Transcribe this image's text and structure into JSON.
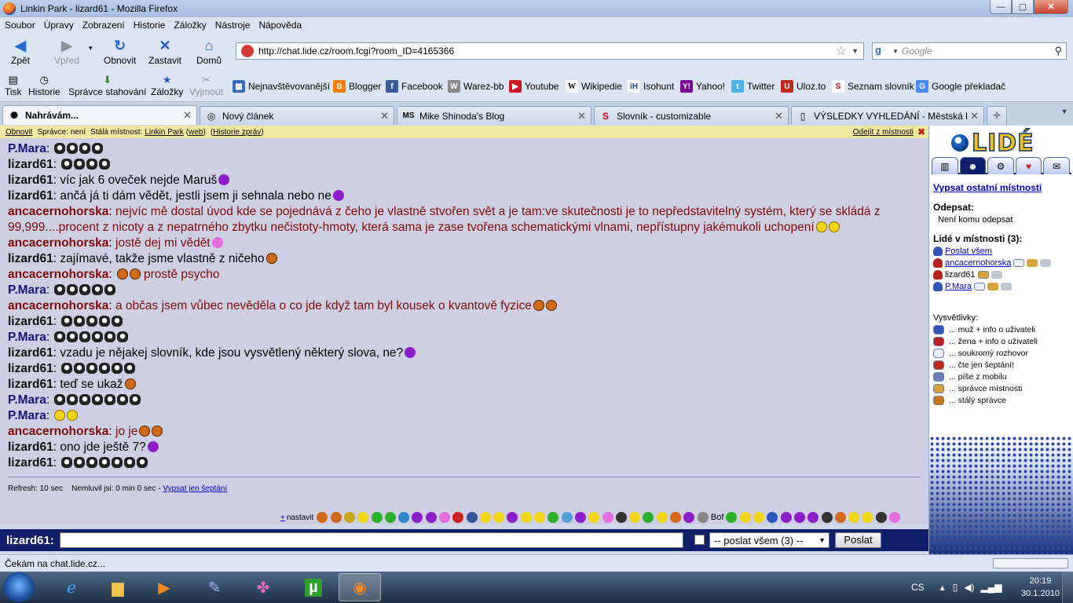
{
  "window": {
    "title": "Linkin Park - lizard61 - Mozilla Firefox"
  },
  "menu": [
    "Soubor",
    "Úpravy",
    "Zobrazení",
    "Historie",
    "Záložky",
    "Nástroje",
    "Nápověda"
  ],
  "nav": {
    "back": "Zpět",
    "forward": "Vpřed",
    "reload": "Obnovit",
    "stop": "Zastavit",
    "home": "Domů",
    "url": "http://chat.lide.cz/room.fcgi?room_ID=4165366",
    "search_placeholder": "Google"
  },
  "tools": {
    "print": "Tisk",
    "history": "Historie",
    "downloads": "Správce stahování",
    "bookmarks": "Záložky",
    "cut": "Vyjmout"
  },
  "bookmarks": [
    "Nejnavštěvovanější",
    "Blogger",
    "Facebook",
    "Warez-bb",
    "Youtube",
    "Wikipedie",
    "Isohunt",
    "Yahoo!",
    "Twitter",
    "Uloz.to",
    "Seznam slovník",
    "Google překladač"
  ],
  "tabs": [
    "Nahrávám...",
    "Nový článek",
    "Mike Shinoda's Blog",
    "Slovník - customizable",
    "VÝSLEDKY VYHLEDÁNÍ - Městská k..."
  ],
  "room_bar": {
    "refresh": "Obnovit",
    "admin": "Správce: není",
    "permanent_prefix": "Stálá místnost:",
    "room_name": "Linkin Park",
    "web": "web",
    "history": "Historie zpráv",
    "leave": "Odejít z místnosti"
  },
  "messages": [
    {
      "nick": "P.Mara",
      "g": "male",
      "text": "",
      "after": 4,
      "icon": "sheep"
    },
    {
      "nick": "lizard61",
      "g": "self",
      "text": "",
      "after": 4,
      "icon": "sheep"
    },
    {
      "nick": "lizard61",
      "g": "self",
      "text": "víc jak 6 oveček nejde Maruš",
      "after": 1,
      "icon": "purple"
    },
    {
      "nick": "lizard61",
      "g": "self",
      "text": "ančá já ti dám vědět, jestli jsem ji sehnala nebo ne",
      "after": 1,
      "icon": "purple"
    },
    {
      "nick": "ancacernohorska",
      "g": "female",
      "text": "nejvíc mě dostal úvod kde se pojednává z čeho je vlastně stvořen svět a je tam:ve skutečnosti je to nepředstavitelný systém, který se skládá z 99,999....procent z nicoty a z nepatrného zbytku nečistoty-hmoty, která sama je zase tvořena schematickými vlnami, nepřístupny jakémukoli uchopení",
      "after": 2,
      "icon": "yellow"
    },
    {
      "nick": "ancacernohorska",
      "g": "female",
      "text": "jostě dej mi vědět",
      "after": 1,
      "icon": "pink"
    },
    {
      "nick": "lizard61",
      "g": "self",
      "text": "zajímavé, takže jsme vlastně z ničeho",
      "after": 1,
      "icon": "orange"
    },
    {
      "nick": "ancacernohorska",
      "g": "female",
      "text": "prostě psycho",
      "before": 2,
      "icon": "orange"
    },
    {
      "nick": "P.Mara",
      "g": "male",
      "text": "",
      "after": 5,
      "icon": "sheep"
    },
    {
      "nick": "ancacernohorska",
      "g": "female",
      "text": "a občas jsem vůbec nevěděla o co jde když tam byl kousek o kvantově fyzice",
      "after": 2,
      "icon": "orange"
    },
    {
      "nick": "lizard61",
      "g": "self",
      "text": "",
      "after": 5,
      "icon": "sheep"
    },
    {
      "nick": "P.Mara",
      "g": "male",
      "text": "",
      "after": 6,
      "icon": "sheep"
    },
    {
      "nick": "lizard61",
      "g": "self",
      "text": "vzadu je nějakej slovník, kde jsou vysvětlený některý slova, ne?",
      "after": 1,
      "icon": "purple"
    },
    {
      "nick": "lizard61",
      "g": "self",
      "text": "",
      "after": 6,
      "icon": "sheep"
    },
    {
      "nick": "lizard61",
      "g": "self",
      "text": "teď se ukaž",
      "after": 1,
      "icon": "orange"
    },
    {
      "nick": "P.Mara",
      "g": "male",
      "text": "",
      "after": 7,
      "icon": "sheep"
    },
    {
      "nick": "P.Mara",
      "g": "male",
      "text": "",
      "after": 2,
      "icon": "yellow"
    },
    {
      "nick": "ancacernohorska",
      "g": "female",
      "text": "jo je",
      "after": 2,
      "icon": "orange"
    },
    {
      "nick": "lizard61",
      "g": "self",
      "text": "ono jde ještě 7?",
      "after": 1,
      "icon": "purple"
    },
    {
      "nick": "lizard61",
      "g": "self",
      "text": "",
      "after": 7,
      "icon": "sheep"
    }
  ],
  "status": {
    "refresh": "Refresh: 10 sec",
    "idle": "Nemluvil jsi: 0 min 0 sec -",
    "whisper_link": "Vypsat jen šeptání"
  },
  "smiley_bar": {
    "plus": "+",
    "label": "nastavit",
    "bof": "Bof"
  },
  "input": {
    "nick": "lizard61:",
    "target": "-- poslat všem (3) --",
    "send": "Poslat"
  },
  "panel": {
    "logo": "LIDÉ",
    "other_rooms": "Vypsat ostatní místnosti",
    "reply_head": "Odepsat:",
    "reply_none": "Není komu odepsat",
    "people_head": "Lidé v místnosti (3):",
    "send_all": "Poslat všem",
    "users": [
      {
        "name": "ancacernohorska",
        "g": "f",
        "link": true
      },
      {
        "name": "lizard61",
        "g": "f",
        "link": false
      },
      {
        "name": "P.Mara",
        "g": "m",
        "link": true
      }
    ],
    "legend_head": "Vysvětlivky:",
    "legend": [
      "... muž + info o uživateli",
      "... žena + info o uživateli",
      "... soukromý rozhovor",
      "... čte jen šeptání!",
      "... píše z mobilu",
      "... správce místnosti",
      "... stálý správce"
    ]
  },
  "statusbar": {
    "text": "Čekám na chat.lide.cz..."
  },
  "taskbar": {
    "lang": "CS",
    "time": "20:19",
    "date": "30.1.2010"
  },
  "colors": {
    "male_nick": "#15157a",
    "female_nick": "#7d0b0b",
    "chat_bg": "#cfcfe4",
    "input_bar": "#0f1f6a"
  }
}
